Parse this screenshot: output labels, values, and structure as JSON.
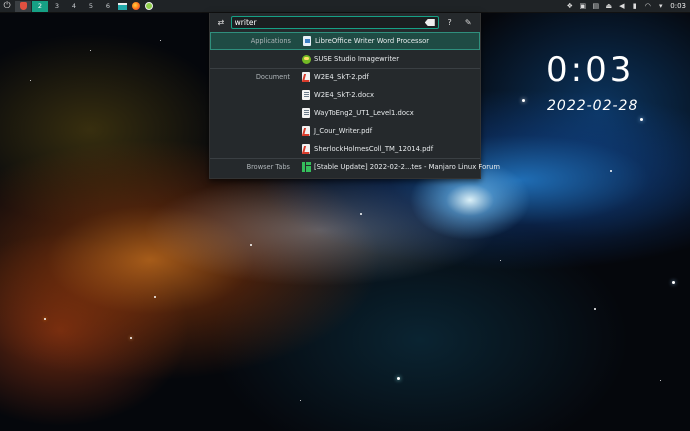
{
  "panel": {
    "desktops": [
      "2",
      "3",
      "4",
      "5",
      "6"
    ],
    "clock": "0:03"
  },
  "runner": {
    "query": "writer",
    "help_glyph": "?",
    "results": [
      {
        "category": "Applications",
        "icon": "libreoffice-writer-icon",
        "label": "LibreOffice Writer  Word Processor"
      },
      {
        "category": "",
        "icon": "suse-imagewriter-icon",
        "label": "SUSE Studio Imagewriter"
      },
      {
        "category": "Document",
        "icon": "pdf-file-icon",
        "label": "W2E4_SkT-2.pdf"
      },
      {
        "category": "",
        "icon": "docx-file-icon",
        "label": "W2E4_SkT-2.docx"
      },
      {
        "category": "",
        "icon": "docx-file-icon",
        "label": "WayToEng2_UT1_Level1.docx"
      },
      {
        "category": "",
        "icon": "pdf-file-icon",
        "label": "J_Cour_Writer.pdf"
      },
      {
        "category": "",
        "icon": "pdf-file-icon",
        "label": "SherlockHolmesColl_TM_12014.pdf"
      },
      {
        "category": "Browser Tabs",
        "icon": "manjaro-forum-icon",
        "label": "[Stable Update] 2022-02-2...tes - Manjaro Linux Forum"
      }
    ]
  },
  "desktop_clock": {
    "time": "0:03",
    "date": "2022-02-28"
  },
  "colors": {
    "accent": "#16a085",
    "selection": "#1f4b44",
    "panel": "#1f2326",
    "runner_bg": "#25292c"
  }
}
